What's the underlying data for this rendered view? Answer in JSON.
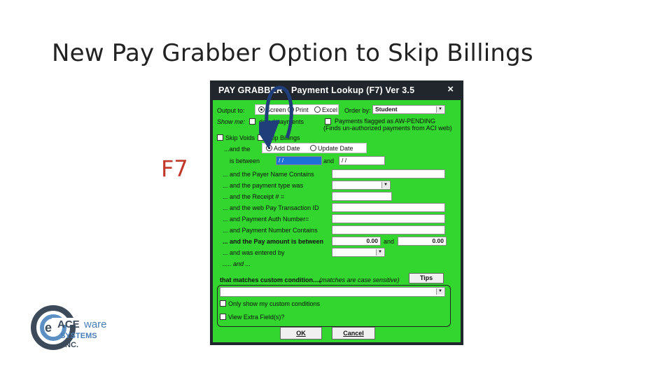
{
  "slide": {
    "title": "New Pay Grabber Option to Skip Billings",
    "f7_label": "F7"
  },
  "window": {
    "title": "PAY GRABBER  - Payment Lookup (F7)    Ver 3.5",
    "close": "×"
  },
  "form": {
    "output_to_label": "Output to:",
    "output_opt1": "Screen",
    "output_opt2": "Print",
    "output_opt3": "Excel",
    "order_by_label": "Order by:",
    "order_by_value": "Student",
    "show_me_label": "Show me:",
    "show_me_opt": "dated payments",
    "aw_pending_label": "Payments flagged as AW-PENDING",
    "aw_pending_sub": "(Finds un-authorized payments from ACI web)",
    "skip_voids": "Skip Voids",
    "skip_billings": "Skip Billings",
    "and_the": "...and the",
    "add_date": "Add Date",
    "update_date": "Update Date",
    "is_between": "is between",
    "date_from": "/ /",
    "and": "and",
    "date_to": "/ /",
    "payer_name": "... and the Payer Name Contains",
    "payment_type": "... and the payment type was",
    "receipt": "... and the Receipt # =",
    "web_pay": "... and the web Pay Transaction ID",
    "auth_number": "... and Payment Auth Number=",
    "payment_number": "... and Payment Number Contains",
    "pay_amount": "... and the Pay amount is between",
    "amount_from": "0.00",
    "amount_and": "and",
    "amount_to": "0.00",
    "entered_by": "... and was entered by",
    "and_more": "..... and ...",
    "custom_condition": "that matches custom condition.....",
    "case_sensitive": "(matches are case sensitive)",
    "tips": "Tips",
    "only_custom": "Only show my custom conditions",
    "view_extra": "View Extra Field(s)?",
    "ok": "OK",
    "cancel": "Cancel"
  },
  "logo": {
    "ace": "ACE",
    "ware": "ware",
    "systems": "SYSTEMS",
    "inc": "INC."
  }
}
